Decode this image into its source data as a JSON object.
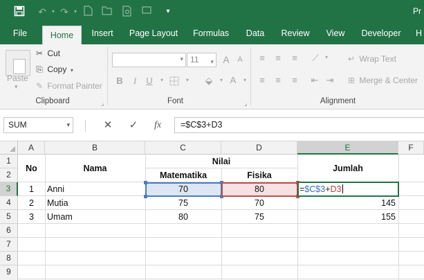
{
  "title_bar": {
    "doc_title": "Pr",
    "qat_icons": [
      "save-icon",
      "undo-icon",
      "redo-icon",
      "new-file-icon",
      "open-icon",
      "print-preview-icon",
      "more-icon"
    ]
  },
  "tabs": [
    {
      "label": "File"
    },
    {
      "label": "Home",
      "active": true
    },
    {
      "label": "Insert"
    },
    {
      "label": "Page Layout"
    },
    {
      "label": "Formulas"
    },
    {
      "label": "Data"
    },
    {
      "label": "Review"
    },
    {
      "label": "View"
    },
    {
      "label": "Developer"
    },
    {
      "label": "H"
    }
  ],
  "ribbon": {
    "clipboard": {
      "label": "Clipboard",
      "paste": "Paste",
      "cut": "Cut",
      "copy": "Copy",
      "format_painter": "Format Painter"
    },
    "font": {
      "label": "Font",
      "font_name": "",
      "font_size": "11",
      "bold": "B",
      "italic": "I",
      "underline": "U",
      "grow": "A",
      "shrink": "A",
      "font_color": "A"
    },
    "alignment": {
      "label": "Alignment",
      "wrap_text": "Wrap Text",
      "merge_center": "Merge & Center"
    }
  },
  "formula_bar": {
    "name_box": "SUM",
    "cancel": "✕",
    "enter": "✓",
    "fx": "fx",
    "formula": "=$C$3+D3"
  },
  "sheet": {
    "columns": [
      "A",
      "B",
      "C",
      "D",
      "E",
      "F"
    ],
    "rows": [
      "1",
      "2",
      "3",
      "4",
      "5",
      "6",
      "7",
      "8",
      "9"
    ],
    "selected_column": "E",
    "selected_row": "3",
    "headers": {
      "no": "No",
      "nama": "Nama",
      "nilai": "Nilai",
      "matematika": "Matematika",
      "fisika": "Fisika",
      "jumlah": "Jumlah"
    },
    "records": [
      {
        "no": "1",
        "nama": "Anni",
        "matematika": "70",
        "fisika": "80",
        "jumlah": ""
      },
      {
        "no": "2",
        "nama": "Mutia",
        "matematika": "75",
        "fisika": "70",
        "jumlah": "145"
      },
      {
        "no": "3",
        "nama": "Umam",
        "matematika": "80",
        "fisika": "75",
        "jumlah": "155"
      }
    ],
    "editing_cell": {
      "eq": "=",
      "ref1": "$C$3",
      "plus": "+",
      "ref2": "D3"
    }
  },
  "colors": {
    "excel_green": "#217346",
    "ref_blue": "#4a7cc4",
    "ref_red": "#c0504d"
  }
}
